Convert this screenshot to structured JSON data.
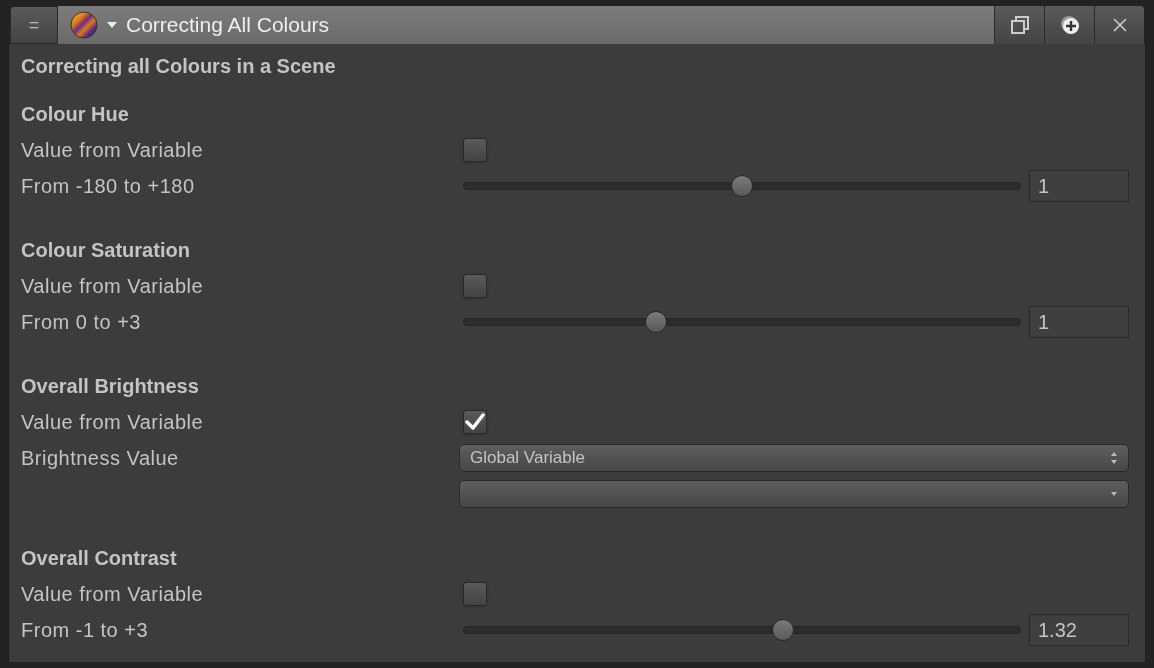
{
  "window": {
    "title": "Correcting All Colours",
    "menu_icon": "="
  },
  "heading": "Correcting all Colours in a Scene",
  "sections": [
    {
      "title": "Colour Hue",
      "rows": [
        {
          "kind": "checkbox",
          "label": "Value from Variable",
          "checked": false
        },
        {
          "kind": "slider",
          "label": "From -180 to +180",
          "level": 0.5,
          "value": "1"
        }
      ]
    },
    {
      "title": "Colour Saturation",
      "rows": [
        {
          "kind": "checkbox",
          "label": "Value from Variable",
          "checked": false
        },
        {
          "kind": "slider",
          "label": "From 0 to +3",
          "level": 0.34,
          "value": "1"
        }
      ]
    },
    {
      "title": "Overall Brightness",
      "rows": [
        {
          "kind": "checkbox",
          "label": "Value from Variable",
          "checked": true
        },
        {
          "kind": "select",
          "label": "Brightness Value",
          "value": "Global Variable"
        },
        {
          "kind": "dropdown"
        }
      ]
    },
    {
      "title": "Overall Contrast",
      "rows": [
        {
          "kind": "checkbox",
          "label": "Value from Variable",
          "checked": false
        },
        {
          "kind": "slider",
          "label": "From -1 to +3",
          "level": 0.577,
          "value": "1.32"
        }
      ]
    }
  ]
}
